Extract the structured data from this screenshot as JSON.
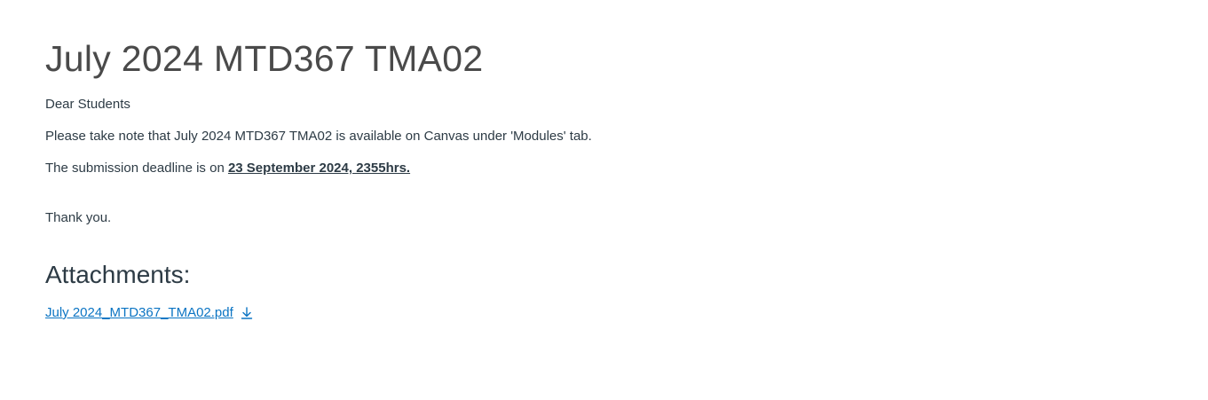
{
  "announcement": {
    "title": "July 2024 MTD367 TMA02",
    "greeting": "Dear Students",
    "notice": "Please take note that July 2024 MTD367 TMA02 is available on Canvas under 'Modules' tab.",
    "deadline_prefix": "The submission deadline is on ",
    "deadline_value": "23 September 2024, 2355hrs.",
    "closing": "Thank you."
  },
  "attachments": {
    "heading": "Attachments:",
    "items": [
      {
        "filename": "July 2024_MTD367_TMA02.pdf",
        "icon": "download-icon"
      }
    ]
  },
  "colors": {
    "text": "#2d3b45",
    "title": "#4a4a4a",
    "link": "#0b74c3"
  }
}
